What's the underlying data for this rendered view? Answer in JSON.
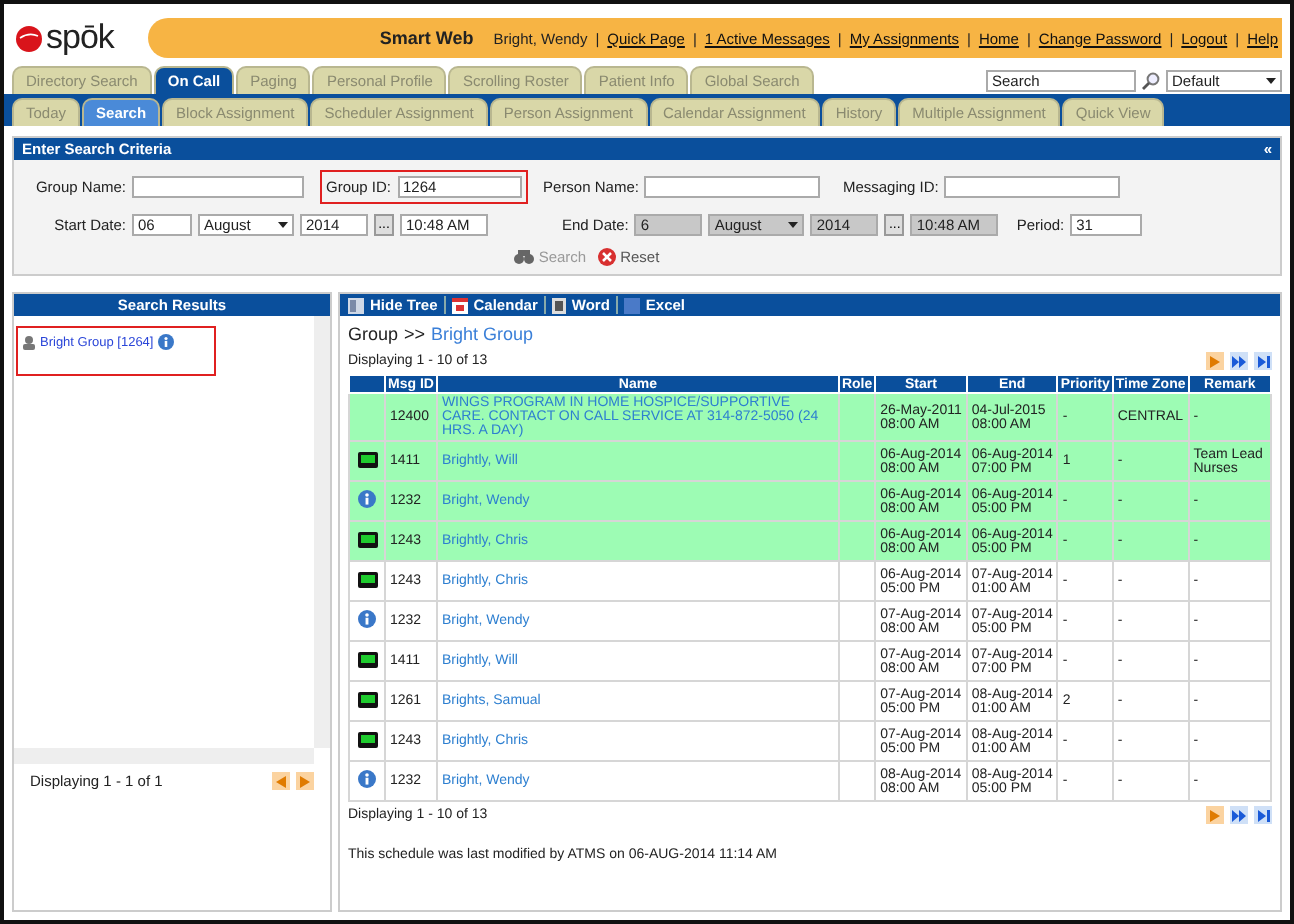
{
  "header": {
    "logo": "spōk",
    "app_title": "Smart Web",
    "user": "Bright, Wendy",
    "separator": "|",
    "links": [
      "Quick Page",
      "1 Active Messages",
      "My Assignments",
      "Home",
      "Change Password",
      "Logout",
      "Help"
    ]
  },
  "main_tabs": [
    {
      "label": "Directory Search",
      "selected": false
    },
    {
      "label": "On Call",
      "selected": true
    },
    {
      "label": "Paging",
      "selected": false
    },
    {
      "label": "Personal Profile",
      "selected": false
    },
    {
      "label": "Scrolling Roster",
      "selected": false
    },
    {
      "label": "Patient Info",
      "selected": false
    },
    {
      "label": "Global Search",
      "selected": false
    }
  ],
  "global_search": {
    "value": "Search",
    "scope": "Default"
  },
  "sub_tabs": [
    {
      "label": "Today",
      "selected": false
    },
    {
      "label": "Search",
      "selected": true
    },
    {
      "label": "Block Assignment",
      "selected": false
    },
    {
      "label": "Scheduler Assignment",
      "selected": false
    },
    {
      "label": "Person Assignment",
      "selected": false
    },
    {
      "label": "Calendar Assignment",
      "selected": false
    },
    {
      "label": "History",
      "selected": false
    },
    {
      "label": "Multiple Assignment",
      "selected": false
    },
    {
      "label": "Quick View",
      "selected": false
    }
  ],
  "criteria": {
    "title": "Enter Search Criteria",
    "collapse": "«",
    "fields": [
      {
        "label": "Group Name:",
        "outlined": false
      },
      {
        "label": "Group ID:",
        "value": "1264",
        "outlined": true
      },
      {
        "label": "Person Name:",
        "outlined": false
      },
      {
        "label": "Messaging ID:",
        "outlined": false
      }
    ],
    "start_date": {
      "label": "Start Date:",
      "day": "06",
      "month": "August",
      "year": "2014",
      "picker": "...",
      "time": "10:48 AM",
      "disabled": false
    },
    "end_date": {
      "label": "End Date:",
      "day": "6",
      "month": "August",
      "year": "2014",
      "picker": "...",
      "time": "10:48 AM",
      "disabled": true
    },
    "period": {
      "label": "Period:",
      "value": "31"
    },
    "buttons": [
      {
        "label": "Search",
        "kind": "search",
        "disabled": true
      },
      {
        "label": "Reset",
        "kind": "reset",
        "disabled": false
      }
    ]
  },
  "results": {
    "title": "Search Results",
    "items": [
      {
        "label": "Bright Group [1264]",
        "outlined": true
      }
    ],
    "footer": "Displaying 1 - 1 of 1"
  },
  "toolbar": [
    {
      "label": "Hide Tree",
      "kind": "tree"
    },
    {
      "label": "Calendar",
      "kind": "calendar"
    },
    {
      "label": "Word",
      "kind": "word"
    },
    {
      "label": "Excel",
      "kind": "excel"
    }
  ],
  "breadcrumb": {
    "root": "Group",
    "separator": ">>",
    "current": "Bright Group"
  },
  "display_count": "Displaying 1 - 10 of 13",
  "table": {
    "columns": [
      "Msg ID",
      "Name",
      "Role",
      "Start",
      "End",
      "Priority",
      "Time Zone",
      "Remark"
    ],
    "rows": [
      {
        "kind": "plain",
        "msg_id": "12400",
        "name": "WINGS PROGRAM IN HOME HOSPICE/SUPPORTIVE CARE. CONTACT ON CALL SERVICE AT 314-872-5050 (24 HRS. A DAY)",
        "role": "",
        "start": [
          "26-May-2011",
          "08:00 AM"
        ],
        "end": [
          "04-Jul-2015",
          "08:00 AM"
        ],
        "priority": "-",
        "time_zone": "CENTRAL",
        "remark": "-",
        "highlighted": true
      },
      {
        "kind": "pager",
        "msg_id": "1411",
        "name": "Brightly, Will",
        "role": "",
        "start": [
          "06-Aug-2014",
          "08:00 AM"
        ],
        "end": [
          "06-Aug-2014",
          "07:00 PM"
        ],
        "priority": "1",
        "time_zone": "-",
        "remark": "Team Lead Nurses",
        "highlighted": true
      },
      {
        "kind": "info",
        "msg_id": "1232",
        "name": "Bright, Wendy",
        "role": "",
        "start": [
          "06-Aug-2014",
          "08:00 AM"
        ],
        "end": [
          "06-Aug-2014",
          "05:00 PM"
        ],
        "priority": "-",
        "time_zone": "-",
        "remark": "-",
        "highlighted": true
      },
      {
        "kind": "pager",
        "msg_id": "1243",
        "name": "Brightly, Chris",
        "role": "",
        "start": [
          "06-Aug-2014",
          "08:00 AM"
        ],
        "end": [
          "06-Aug-2014",
          "05:00 PM"
        ],
        "priority": "-",
        "time_zone": "-",
        "remark": "-",
        "highlighted": true
      },
      {
        "kind": "pager",
        "msg_id": "1243",
        "name": "Brightly, Chris",
        "role": "",
        "start": [
          "06-Aug-2014",
          "05:00 PM"
        ],
        "end": [
          "07-Aug-2014",
          "01:00 AM"
        ],
        "priority": "-",
        "time_zone": "-",
        "remark": "-",
        "highlighted": false
      },
      {
        "kind": "info",
        "msg_id": "1232",
        "name": "Bright, Wendy",
        "role": "",
        "start": [
          "07-Aug-2014",
          "08:00 AM"
        ],
        "end": [
          "07-Aug-2014",
          "05:00 PM"
        ],
        "priority": "-",
        "time_zone": "-",
        "remark": "-",
        "highlighted": false
      },
      {
        "kind": "pager",
        "msg_id": "1411",
        "name": "Brightly, Will",
        "role": "",
        "start": [
          "07-Aug-2014",
          "08:00 AM"
        ],
        "end": [
          "07-Aug-2014",
          "07:00 PM"
        ],
        "priority": "-",
        "time_zone": "-",
        "remark": "-",
        "highlighted": false
      },
      {
        "kind": "pager",
        "msg_id": "1261",
        "name": "Brights, Samual",
        "role": "",
        "start": [
          "07-Aug-2014",
          "05:00 PM"
        ],
        "end": [
          "08-Aug-2014",
          "01:00 AM"
        ],
        "priority": "2",
        "time_zone": "-",
        "remark": "-",
        "highlighted": false
      },
      {
        "kind": "pager",
        "msg_id": "1243",
        "name": "Brightly, Chris",
        "role": "",
        "start": [
          "07-Aug-2014",
          "05:00 PM"
        ],
        "end": [
          "08-Aug-2014",
          "01:00 AM"
        ],
        "priority": "-",
        "time_zone": "-",
        "remark": "-",
        "highlighted": false
      },
      {
        "kind": "info",
        "msg_id": "1232",
        "name": "Bright, Wendy",
        "role": "",
        "start": [
          "08-Aug-2014",
          "08:00 AM"
        ],
        "end": [
          "08-Aug-2014",
          "05:00 PM"
        ],
        "priority": "-",
        "time_zone": "-",
        "remark": "-",
        "highlighted": false
      }
    ]
  },
  "footer_count": "Displaying 1 - 10 of 13",
  "modified_note": "This schedule was last modified by ATMS on 06-AUG-2014 11:14 AM"
}
